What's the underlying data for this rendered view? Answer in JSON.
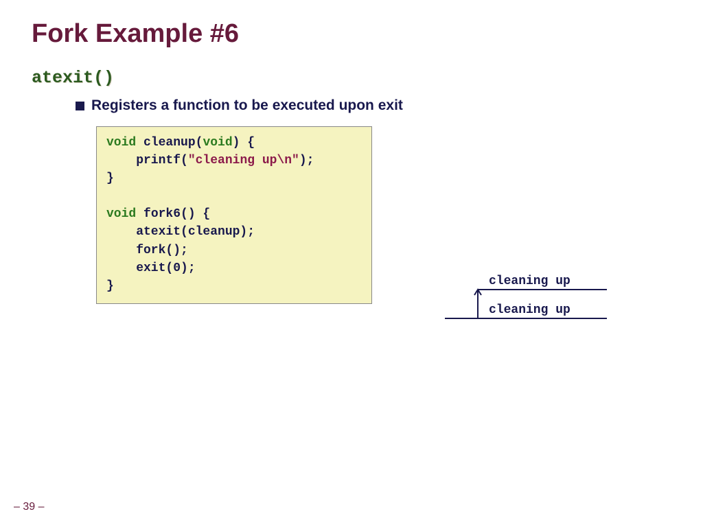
{
  "title": "Fork Example #6",
  "subheading": "atexit()",
  "bullet": "Registers a function to be executed upon exit",
  "code": {
    "l1a": "void",
    "l1b": " cleanup(",
    "l1c": "void",
    "l1d": ") {",
    "l2a": "    printf(",
    "l2b": "\"cleaning up\\n\"",
    "l2c": ");",
    "l3": "}",
    "blank": "",
    "l4a": "void",
    "l4b": " fork6() {",
    "l5": "    atexit(cleanup);",
    "l6": "    fork();",
    "l7": "    exit(0);",
    "l8": "}"
  },
  "diagram": {
    "upper": "cleaning up",
    "lower": "cleaning up"
  },
  "footer": "– 39 –"
}
